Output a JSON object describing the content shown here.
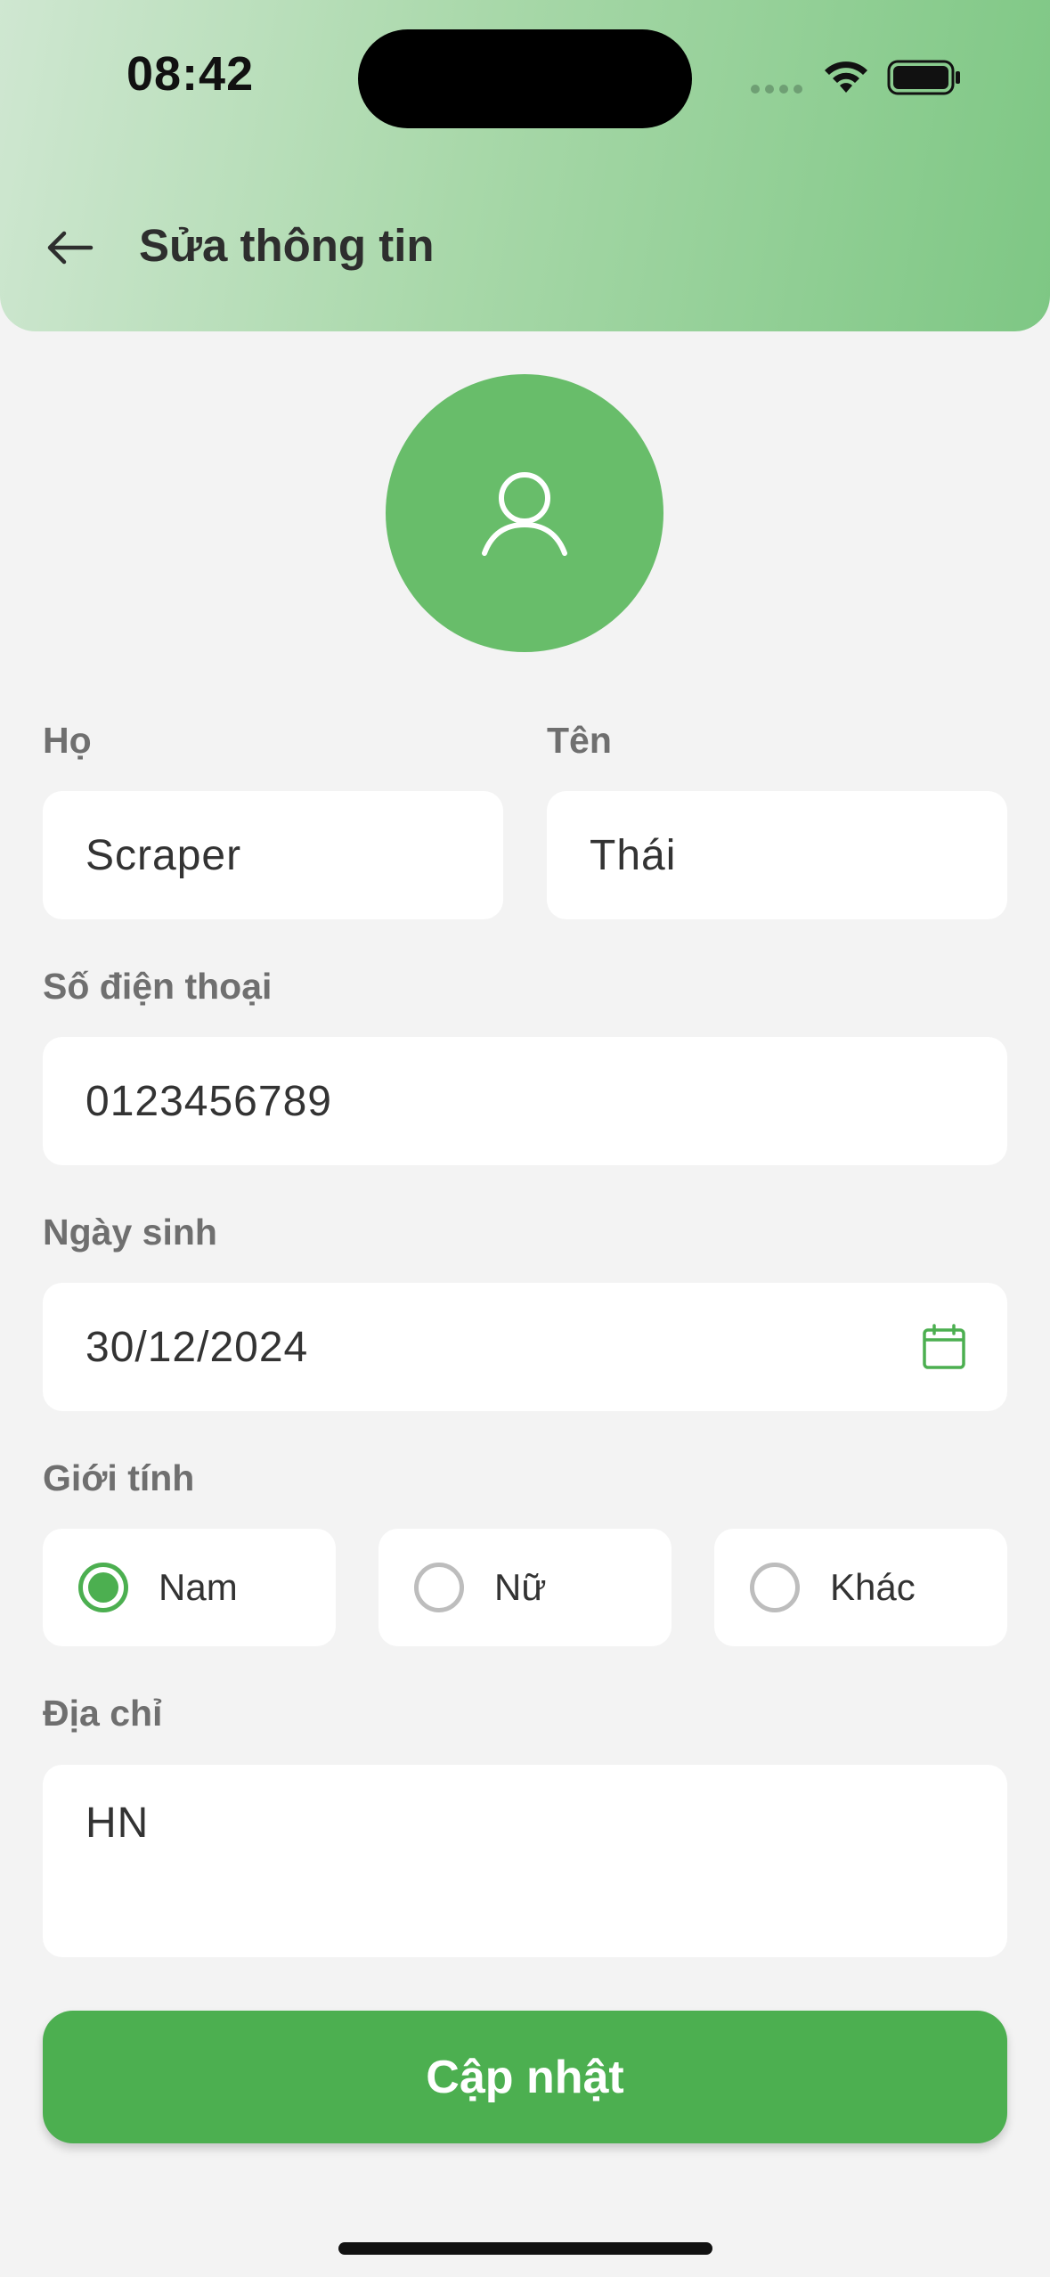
{
  "status_bar": {
    "time": "08:42",
    "icons": [
      "cellular-dots-icon",
      "wifi-icon",
      "battery-icon"
    ]
  },
  "header": {
    "back_icon": "arrow-left-icon",
    "title": "Sửa thông tin"
  },
  "avatar": {
    "icon": "user-icon",
    "color": "#68bd6a"
  },
  "form": {
    "last_name": {
      "label": "Họ",
      "value": "Scraper"
    },
    "first_name": {
      "label": "Tên",
      "value": "Thái"
    },
    "phone": {
      "label": "Số điện thoại",
      "value": "0123456789"
    },
    "birthday": {
      "label": "Ngày sinh",
      "value": "30/12/2024",
      "icon": "calendar-icon"
    },
    "gender": {
      "label": "Giới tính",
      "options": [
        {
          "label": "Nam",
          "selected": true
        },
        {
          "label": "Nữ",
          "selected": false
        },
        {
          "label": "Khác",
          "selected": false
        }
      ]
    },
    "address": {
      "label": "Địa chỉ",
      "value": "HN"
    }
  },
  "submit_label": "Cập nhật",
  "colors": {
    "accent": "#4caf50",
    "header_gradient_start": "#cfe7d1",
    "header_gradient_end": "#7ec784",
    "background": "#f3f3f3"
  }
}
